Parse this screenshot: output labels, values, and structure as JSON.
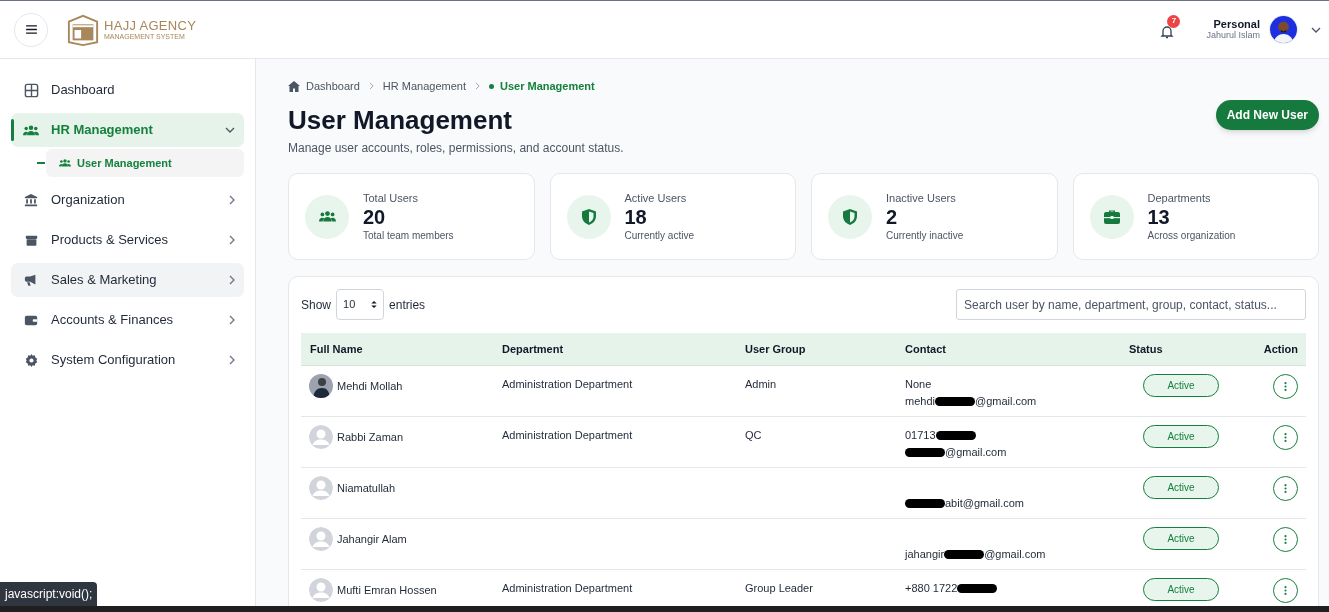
{
  "header": {
    "logo_title": "HAJJ AGENCY",
    "logo_subtitle": "MANAGEMENT SYSTEM",
    "notification_count": "7",
    "user": {
      "role": "Personal",
      "name": "Jahurul Islam"
    }
  },
  "sidebar": {
    "items": [
      {
        "label": "Dashboard",
        "selected": false
      },
      {
        "label": "HR Management",
        "selected": true,
        "expanded": true,
        "children": [
          {
            "label": "User Management",
            "selected": true
          }
        ]
      },
      {
        "label": "Organization",
        "selected": false,
        "expanded": false
      },
      {
        "label": "Products & Services",
        "selected": false,
        "expanded": false
      },
      {
        "label": "Sales & Marketing",
        "selected": false,
        "hovered": true,
        "expanded": false
      },
      {
        "label": "Accounts & Finances",
        "selected": false,
        "expanded": false
      },
      {
        "label": "System Configuration",
        "selected": false,
        "expanded": false
      }
    ]
  },
  "breadcrumb": [
    {
      "label": "Dashboard",
      "current": false
    },
    {
      "label": "HR Management",
      "current": false
    },
    {
      "label": "User Management",
      "current": true
    }
  ],
  "page": {
    "title": "User Management",
    "subtitle": "Manage user accounts, roles, permissions, and account status.",
    "action": "Add New User"
  },
  "stats": [
    {
      "label": "Total Users",
      "value": "20",
      "note": "Total team members"
    },
    {
      "label": "Active Users",
      "value": "18",
      "note": "Currently active"
    },
    {
      "label": "Inactive Users",
      "value": "2",
      "note": "Currently inactive"
    },
    {
      "label": "Departments",
      "value": "13",
      "note": "Across organization"
    }
  ],
  "table": {
    "show_label": "Show",
    "page_size": "10",
    "entries_label": "entries",
    "search_placeholder": "Search user by name, department, group, contact, status...",
    "columns": [
      "Full Name",
      "Department",
      "User Group",
      "Contact",
      "Status",
      "Action"
    ],
    "rows": [
      {
        "name": "Mehdi Mollah",
        "department": "Administration Department",
        "group": "Admin",
        "phone": [
          {
            "kind": "text",
            "text": "None"
          }
        ],
        "email": [
          {
            "kind": "text",
            "text": "mehdi"
          },
          {
            "kind": "redaction"
          },
          {
            "kind": "text",
            "text": "@gmail.com"
          }
        ],
        "status": "Active"
      },
      {
        "name": "Rabbi Zaman",
        "kind": "placeholder",
        "department": "Administration Department",
        "group": "QC",
        "phone": [
          {
            "kind": "text",
            "text": "01713"
          },
          {
            "kind": "redaction"
          }
        ],
        "email": [
          {
            "kind": "redaction"
          },
          {
            "kind": "text",
            "text": "@gmail.com"
          }
        ],
        "status": "Active"
      },
      {
        "name": "Niamatullah",
        "kind": "placeholder",
        "email": [
          {
            "kind": "redaction"
          },
          {
            "kind": "text",
            "text": "abit@gmail.com"
          }
        ],
        "status": "Active"
      },
      {
        "name": "Jahangir Alam",
        "kind": "placeholder",
        "email": [
          {
            "kind": "text",
            "text": "jahangir"
          },
          {
            "kind": "redaction"
          },
          {
            "kind": "text",
            "text": "@gmail.com"
          }
        ],
        "status": "Active"
      },
      {
        "name": "Mufti Emran Hossen",
        "kind": "placeholder",
        "department": "Administration Department",
        "group": "Group Leader",
        "phone": [
          {
            "kind": "text",
            "text": "+880 1722"
          },
          {
            "kind": "redaction"
          }
        ],
        "status": "Active"
      }
    ]
  },
  "status_tooltip": "javascript:void();"
}
